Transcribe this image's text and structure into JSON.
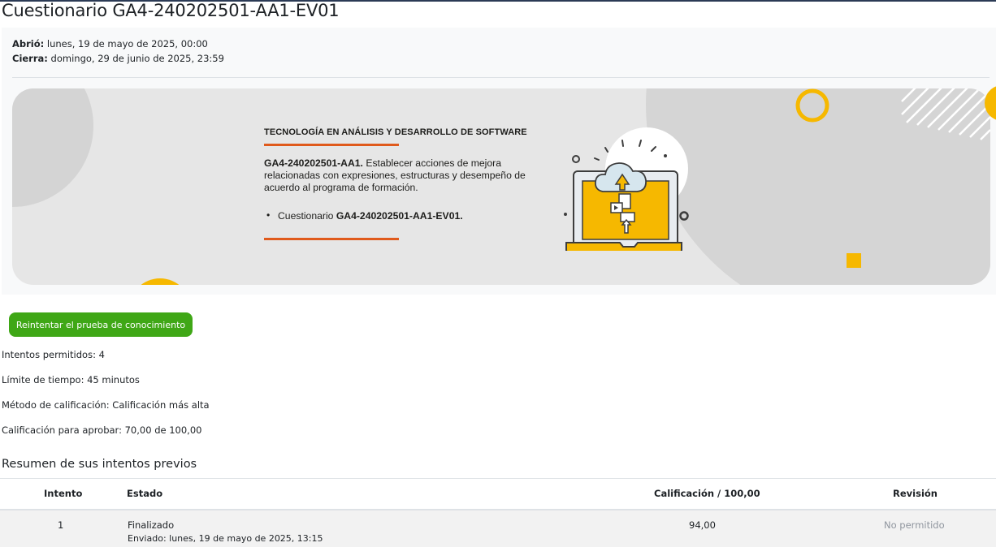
{
  "page": {
    "title": "Cuestionario GA4-240202501-AA1-EV01"
  },
  "dates": {
    "opened_label": "Abrió:",
    "opened_value": "lunes, 19 de mayo de 2025, 00:00",
    "closes_label": "Cierra:",
    "closes_value": "domingo, 29 de junio de 2025, 23:59"
  },
  "banner": {
    "program": "TECNOLOGÍA EN ANÁLISIS Y DESARROLLO DE SOFTWARE",
    "activity_code": "GA4-240202501-AA1.",
    "activity_text": " Establecer acciones de mejora relacionadas con expresiones, estructuras y desempeño de acuerdo al programa de formación.",
    "bullet_prefix": "Cuestionario ",
    "bullet_code": "GA4-240202501-AA1-EV01.",
    "colors": {
      "accent_orange": "#e05a1c",
      "accent_yellow": "#f6b800"
    }
  },
  "actions": {
    "retry_label": "Reintentar el prueba de conocimiento",
    "retry_color": "#3fa716"
  },
  "quiz_info": {
    "attempts_allowed": "Intentos permitidos: 4",
    "time_limit": "Límite de tiempo: 45 minutos",
    "grading_method": "Método de calificación: Calificación más alta",
    "grade_to_pass": "Calificación para aprobar: 70,00 de 100,00"
  },
  "summary": {
    "title": "Resumen de sus intentos previos",
    "headers": [
      "Intento",
      "Estado",
      "Calificación / 100,00",
      "Revisión"
    ],
    "rows": [
      {
        "attempt": "1",
        "status": "Finalizado",
        "submitted": "Enviado: lunes, 19 de mayo de 2025, 13:15",
        "grade": "94,00",
        "review": "No permitido"
      }
    ]
  }
}
